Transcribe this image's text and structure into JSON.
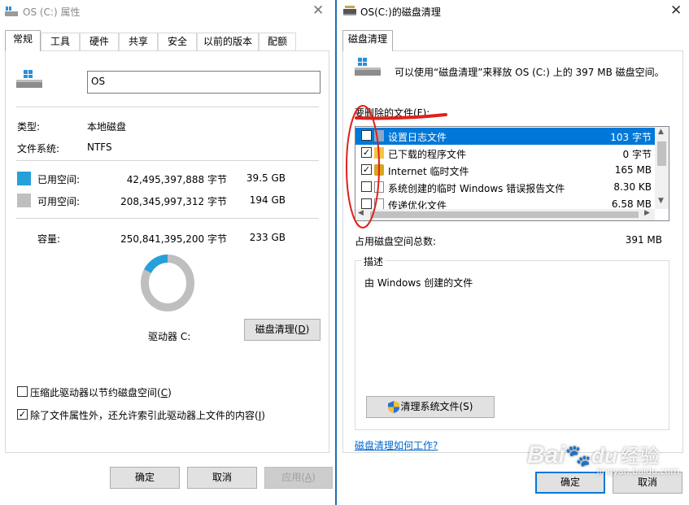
{
  "left_window": {
    "title": "OS (C:) 属性",
    "tabs": [
      "常规",
      "工具",
      "硬件",
      "共享",
      "安全",
      "以前的版本",
      "配额"
    ],
    "drive_name": "OS",
    "type_label": "类型:",
    "type_value": "本地磁盘",
    "fs_label": "文件系统:",
    "fs_value": "NTFS",
    "used_label": "已用空间:",
    "used_bytes": "42,495,397,888 字节",
    "used_size": "39.5 GB",
    "free_label": "可用空间:",
    "free_bytes": "208,345,997,312 字节",
    "free_size": "194 GB",
    "capacity_label": "容量:",
    "capacity_bytes": "250,841,395,200 字节",
    "capacity_size": "233 GB",
    "used_fraction": 0.169,
    "drive_label": "驱动器 C:",
    "cleanup_button_prefix": "磁盘清理(",
    "cleanup_button_key": "D",
    "cleanup_button_suffix": ")",
    "compress_prefix": "压缩此驱动器以节约磁盘空间(",
    "compress_key": "C",
    "compress_suffix": ")",
    "compress_checked": false,
    "index_prefix": "除了文件属性外，还允许索引此驱动器上文件的内容(",
    "index_key": "I",
    "index_suffix": ")",
    "index_checked": true,
    "ok": "确定",
    "cancel": "取消",
    "apply_prefix": "应用(",
    "apply_key": "A",
    "apply_suffix": ")",
    "colors": {
      "used": "#26a0da",
      "free": "#bfbfbf"
    }
  },
  "right_window": {
    "title": "OS(C:)的磁盘清理",
    "tab": "磁盘清理",
    "intro": "可以使用“磁盘清理”来释放 OS (C:) 上的 397 MB 磁盘空间。",
    "files_label": "要删除的文件(F):",
    "files": [
      {
        "name": "设置日志文件",
        "size": "103 字节",
        "checked": false,
        "selected": true,
        "icon": "setup-log-icon"
      },
      {
        "name": "已下载的程序文件",
        "size": "0 字节",
        "checked": true,
        "selected": false,
        "icon": "folder-icon"
      },
      {
        "name": "Internet 临时文件",
        "size": "165 MB",
        "checked": true,
        "selected": false,
        "icon": "lock-icon"
      },
      {
        "name": "系统创建的临时 Windows 错误报告文件",
        "size": "8.30 KB",
        "checked": false,
        "selected": false,
        "icon": "file-icon"
      },
      {
        "name": "传递优化文件",
        "size": "6.58 MB",
        "checked": false,
        "selected": false,
        "icon": "file-icon"
      }
    ],
    "total_label": "占用磁盘空间总数:",
    "total_value": "391 MB",
    "desc_label": "描述",
    "desc_text": "由 Windows 创建的文件",
    "clean_sys_button": "清理系统文件(S)",
    "help_link": "磁盘清理如何工作?",
    "ok": "确定",
    "cancel": "取消",
    "colors": {
      "select": "#0078d7",
      "annotation": "#e0201a"
    }
  },
  "watermark": {
    "text": "Bai",
    "paw": "du",
    "cn": "经验",
    "url": "jingyan.baidu.com"
  }
}
